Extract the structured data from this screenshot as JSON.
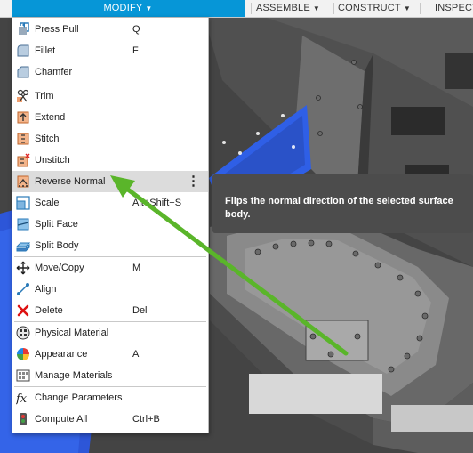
{
  "toolbar": {
    "modify_label": "MODIFY",
    "assemble_label": "ASSEMBLE",
    "construct_label": "CONSTRUCT",
    "inspect_label": "INSPECT"
  },
  "menu": {
    "items": [
      {
        "label": "Press Pull",
        "shortcut": "Q",
        "icon": "press-pull-icon"
      },
      {
        "label": "Fillet",
        "shortcut": "F",
        "icon": "fillet-icon"
      },
      {
        "label": "Chamfer",
        "shortcut": "",
        "icon": "chamfer-icon"
      },
      {
        "label": "Trim",
        "shortcut": "",
        "icon": "trim-icon"
      },
      {
        "label": "Extend",
        "shortcut": "",
        "icon": "extend-icon"
      },
      {
        "label": "Stitch",
        "shortcut": "",
        "icon": "stitch-icon"
      },
      {
        "label": "Unstitch",
        "shortcut": "",
        "icon": "unstitch-icon"
      },
      {
        "label": "Reverse Normal",
        "shortcut": "",
        "icon": "reverse-normal-icon",
        "highlighted": true,
        "more_glyph": "⋮"
      },
      {
        "label": "Scale",
        "shortcut": "Alt+Shift+S",
        "icon": "scale-icon"
      },
      {
        "label": "Split Face",
        "shortcut": "",
        "icon": "split-face-icon"
      },
      {
        "label": "Split Body",
        "shortcut": "",
        "icon": "split-body-icon"
      },
      {
        "label": "Move/Copy",
        "shortcut": "M",
        "icon": "move-copy-icon"
      },
      {
        "label": "Align",
        "shortcut": "",
        "icon": "align-icon"
      },
      {
        "label": "Delete",
        "shortcut": "Del",
        "icon": "delete-icon"
      },
      {
        "label": "Physical Material",
        "shortcut": "",
        "icon": "physical-material-icon"
      },
      {
        "label": "Appearance",
        "shortcut": "A",
        "icon": "appearance-icon"
      },
      {
        "label": "Manage Materials",
        "shortcut": "",
        "icon": "manage-materials-icon"
      },
      {
        "label": "Change Parameters",
        "shortcut": "",
        "icon": "change-parameters-icon"
      },
      {
        "label": "Compute All",
        "shortcut": "Ctrl+B",
        "icon": "compute-all-icon"
      }
    ]
  },
  "tooltip": {
    "text": "Flips the normal direction of the selected surface body."
  },
  "colors": {
    "accent": "#0696d7",
    "annotation_arrow": "#5ab52a",
    "model_blue": "#2255dd"
  }
}
